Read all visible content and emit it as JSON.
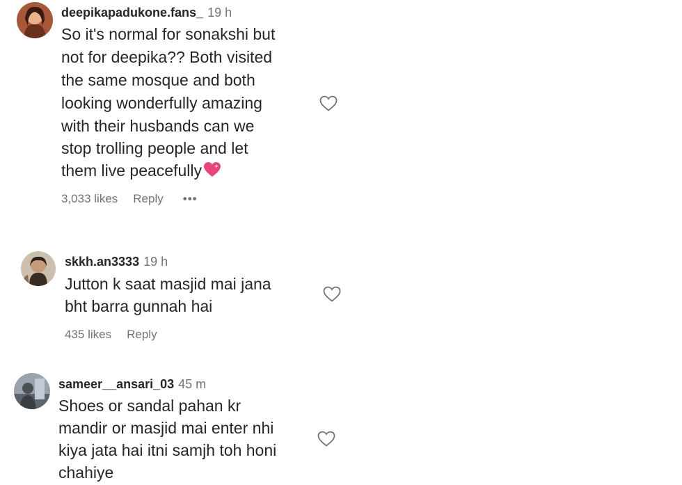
{
  "comments": [
    {
      "username": "deepikapadukone.fans_",
      "time": "19 h",
      "lines": [
        "So it's normal for sonakshi but",
        "not for deepika?? Both visited",
        "the same mosque and both",
        "looking wonderfully amazing",
        "with their husbands can we",
        "stop trolling people and let",
        "them live peacefully"
      ],
      "emoji": "heart-sparkle-emoji",
      "likes": "3,033 likes",
      "reply": "Reply",
      "more": "•••"
    },
    {
      "username": "skkh.an3333",
      "time": "19 h",
      "lines": [
        "Jutton k saat masjid mai jana",
        "bht barra gunnah hai"
      ],
      "likes": "435 likes",
      "reply": "Reply"
    },
    {
      "username": "sameer__ansari_03",
      "time": "45 m",
      "lines": [
        "Shoes or sandal pahan kr",
        "mandir or masjid mai enter nhi",
        "kiya jata hai itni samjh toh honi",
        "chahiye"
      ]
    }
  ],
  "colors": {
    "text": "#262626",
    "secondary": "#737373",
    "heart_emoji": "#e8457a"
  },
  "icons": {
    "like": "heart-outline-icon",
    "more": "more-options-icon"
  }
}
